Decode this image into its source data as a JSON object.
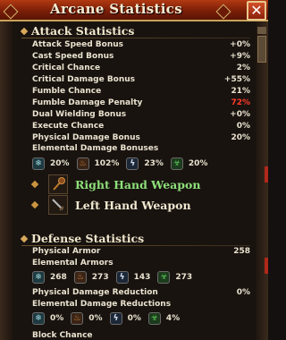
{
  "window": {
    "title": "Arcane Statistics",
    "close_symbol": "✕"
  },
  "attack": {
    "header": "Attack Statistics",
    "rows": [
      {
        "label": "Attack Speed Bonus",
        "value": "+0%"
      },
      {
        "label": "Cast Speed Bonus",
        "value": "+9%"
      },
      {
        "label": "Critical Chance",
        "value": "2%"
      },
      {
        "label": "Critical Damage Bonus",
        "value": "+55%"
      },
      {
        "label": "Fumble Chance",
        "value": "21%"
      },
      {
        "label": "Fumble Damage Penalty",
        "value": "72%"
      },
      {
        "label": "Dual Wielding Bonus",
        "value": "+0%"
      },
      {
        "label": "Execute Chance",
        "value": "0%"
      },
      {
        "label": "Physical Damage Bonus",
        "value": "20%"
      }
    ],
    "elemental_label": "Elemental Damage Bonuses",
    "elemental": [
      {
        "icon": "cold-icon",
        "value": "20%"
      },
      {
        "icon": "fire-icon",
        "value": "102%"
      },
      {
        "icon": "lightning-icon",
        "value": "23%"
      },
      {
        "icon": "poison-icon",
        "value": "20%"
      }
    ],
    "weapons": [
      {
        "label": "Right Hand Weapon",
        "icon": "mace-icon"
      },
      {
        "label": "Left Hand Weapon",
        "icon": "dagger-icon"
      }
    ]
  },
  "defense": {
    "header": "Defense Statistics",
    "physical_armor_label": "Physical Armor",
    "physical_armor_value": "258",
    "elemental_armor_label": "Elemental Armors",
    "elemental_armors": [
      {
        "icon": "cold-icon",
        "value": "268"
      },
      {
        "icon": "fire-icon",
        "value": "273"
      },
      {
        "icon": "lightning-icon",
        "value": "143"
      },
      {
        "icon": "poison-icon",
        "value": "273"
      }
    ],
    "phys_reduction_label": "Physical Damage Reduction",
    "phys_reduction_value": "0%",
    "elem_reduction_label": "Elemental Damage Reductions",
    "elem_reductions": [
      {
        "icon": "cold-icon",
        "value": "0%"
      },
      {
        "icon": "fire-icon",
        "value": "0%"
      },
      {
        "icon": "lightning-icon",
        "value": "0%"
      },
      {
        "icon": "poison-icon",
        "value": "4%"
      }
    ],
    "cutoff_label": "Block Chance"
  },
  "colors": {
    "title_bar": "#9a2a0c",
    "penalty_red": "#ff3a2a",
    "weapon_green": "#8ee07a"
  }
}
